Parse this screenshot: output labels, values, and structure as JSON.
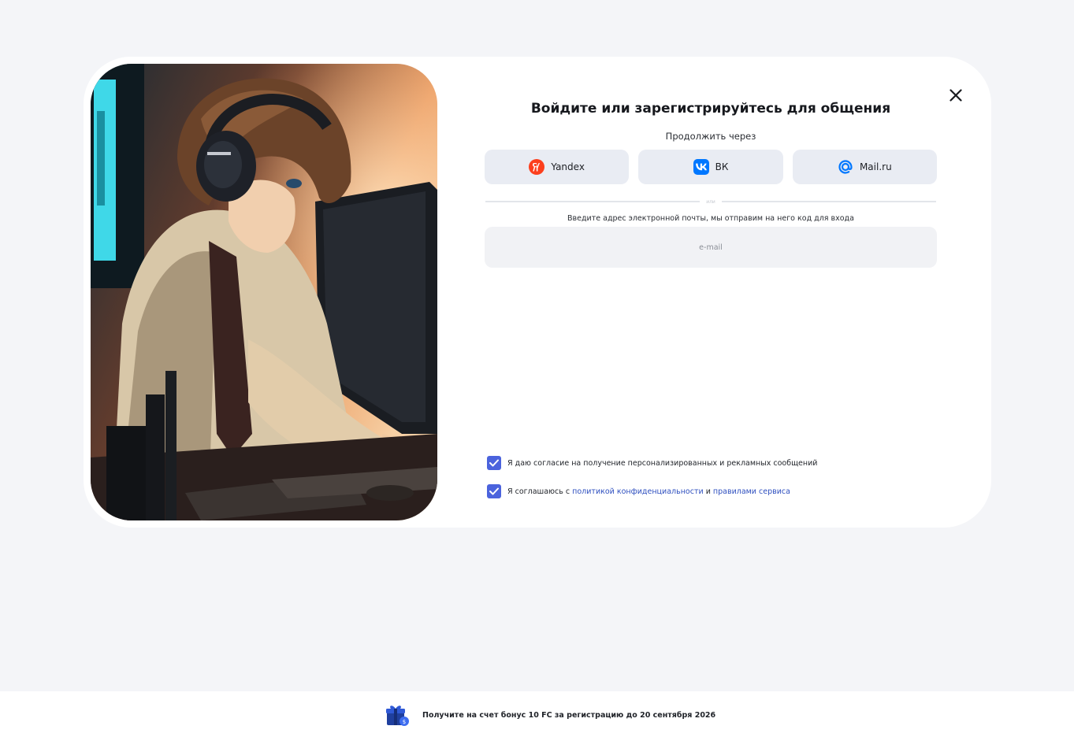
{
  "modal": {
    "title": "Войдите или зарегистрируйтесь для общения",
    "subtitle": "Продолжить через",
    "providers": [
      {
        "label": "Yandex",
        "icon": "yandex-icon",
        "color": "#fc3f1d"
      },
      {
        "label": "ВК",
        "icon": "vk-icon",
        "color": "#0077ff"
      },
      {
        "label": "Mail.ru",
        "icon": "mail-ru-icon",
        "color": "#0077ff"
      }
    ],
    "divider_text": "или",
    "email_hint": "Введите адрес электронной почты, мы отправим на него код для входа",
    "email_placeholder": "e-mail",
    "email_value": "",
    "consent_ads": {
      "checked": true,
      "text": "Я даю согласие на получение персонализированных и рекламных сообщений"
    },
    "consent_terms": {
      "checked": true,
      "text_before": "Я соглашаюсь с",
      "privacy_link": "политикой конфиденциальности",
      "and": "и",
      "rules_link": "правилами сервиса"
    }
  },
  "footer": {
    "bonus_text": "Получите на счет бонус 10 FC за регистрацию до 20 сентября 2026",
    "gift_icon": "gift-icon"
  },
  "colors": {
    "accent": "#4b63dd",
    "link": "#2e4fbf",
    "provider_bg": "#e9ecf3",
    "page_bg": "#f4f5f8"
  }
}
